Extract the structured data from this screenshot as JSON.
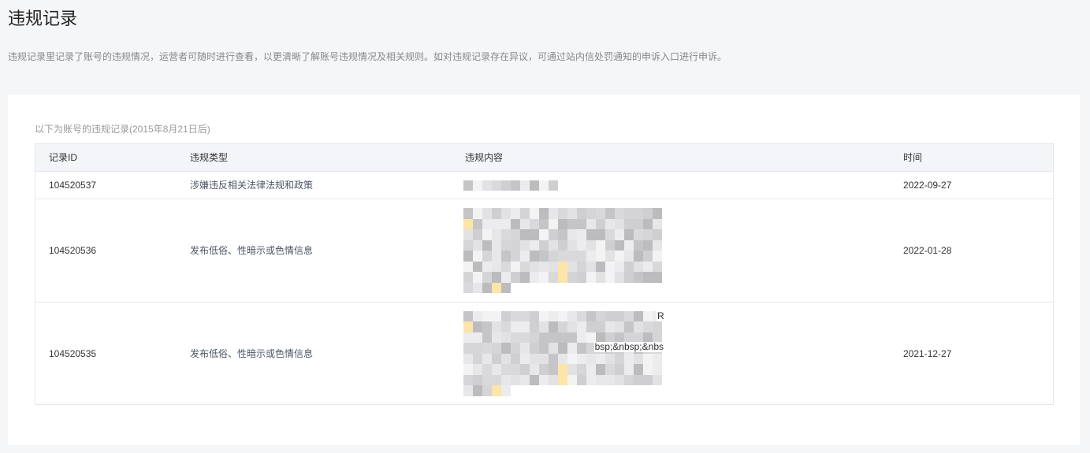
{
  "page": {
    "title": "违规记录",
    "description": "违规记录里记录了账号的违规情况，运营者可随时进行查看，以更清晰了解账号违规情况及相关规则。如对违规记录存在异议，可通过站内信处罚通知的申诉入口进行申诉。"
  },
  "records": {
    "note": "以下为账号的违规记录(2015年8月21日后)",
    "columns": [
      "记录ID",
      "违规类型",
      "违规内容",
      "时间"
    ],
    "rows": [
      {
        "id": "104520537",
        "type": "涉嫌违反相关法律法规和政策",
        "time": "2022-09-27"
      },
      {
        "id": "104520536",
        "type": "发布低俗、性暗示或色情信息",
        "time": "2022-01-28"
      },
      {
        "id": "104520535",
        "type": "发布低俗、性暗示或色情信息",
        "content_fragments": [
          "R",
          "bsp;&nbsp;&nbs"
        ],
        "time": "2021-12-27"
      }
    ]
  },
  "colors": {
    "page_background": "#f5f6f8",
    "card_background": "#ffffff",
    "header_background": "#f4f5f9",
    "border": "#e4e7ec",
    "text": "#333333",
    "muted_text": "#888888",
    "type_text": "#4d5566"
  }
}
